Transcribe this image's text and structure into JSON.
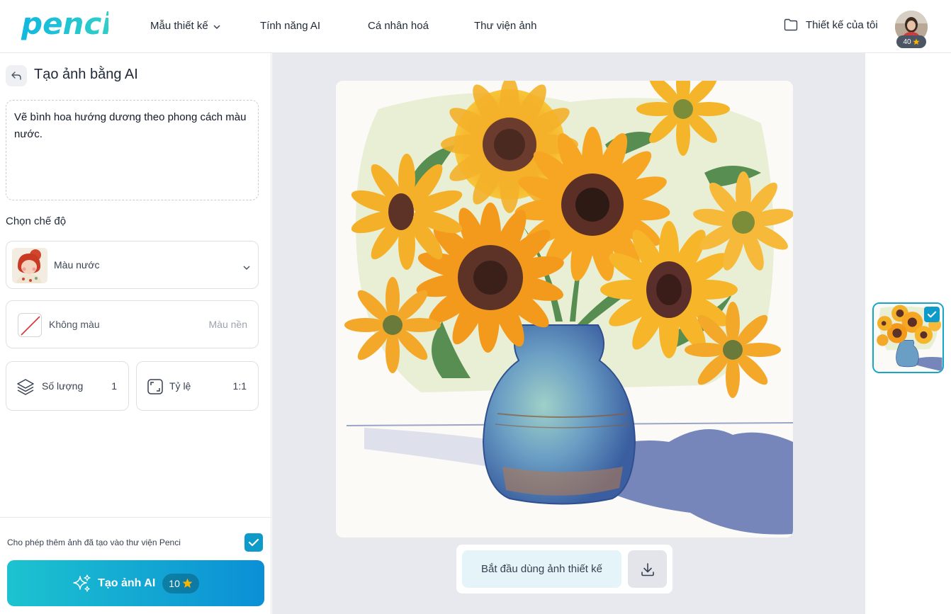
{
  "header": {
    "logo_text": "penci",
    "nav": [
      {
        "label": "Mẫu thiết kế",
        "has_dropdown": true
      },
      {
        "label": "Tính năng AI"
      },
      {
        "label": "Cá nhân hoá"
      },
      {
        "label": "Thư viện ảnh"
      }
    ],
    "my_designs": "Thiết kế của tôi",
    "credits": "40"
  },
  "panel": {
    "title": "Tạo ảnh bằng AI",
    "prompt": "Vẽ bình hoa hướng dương theo phong cách màu nước.",
    "mode_label": "Chọn chế độ",
    "style": {
      "selected": "Màu nước",
      "icon": "chevron-down-icon"
    },
    "color": {
      "label": "Không màu",
      "hint": "Màu nền"
    },
    "quantity": {
      "label": "Số lượng",
      "value": "1"
    },
    "ratio": {
      "label": "Tỷ lệ",
      "value": "1:1"
    },
    "allow_library_text": "Cho phép thêm ảnh đã tạo vào thư viện Penci",
    "allow_library_checked": true,
    "generate": {
      "label": "Tạo ảnh AI",
      "cost": "10"
    }
  },
  "canvas": {
    "use_button": "Bắt đầu dùng ảnh thiết kế",
    "download_icon": "download-icon"
  },
  "colors": {
    "brand": "#1cc3cf",
    "brand_dark": "#0b8fd6",
    "accent_check": "#0e9bc9",
    "star": "#f7b500"
  }
}
